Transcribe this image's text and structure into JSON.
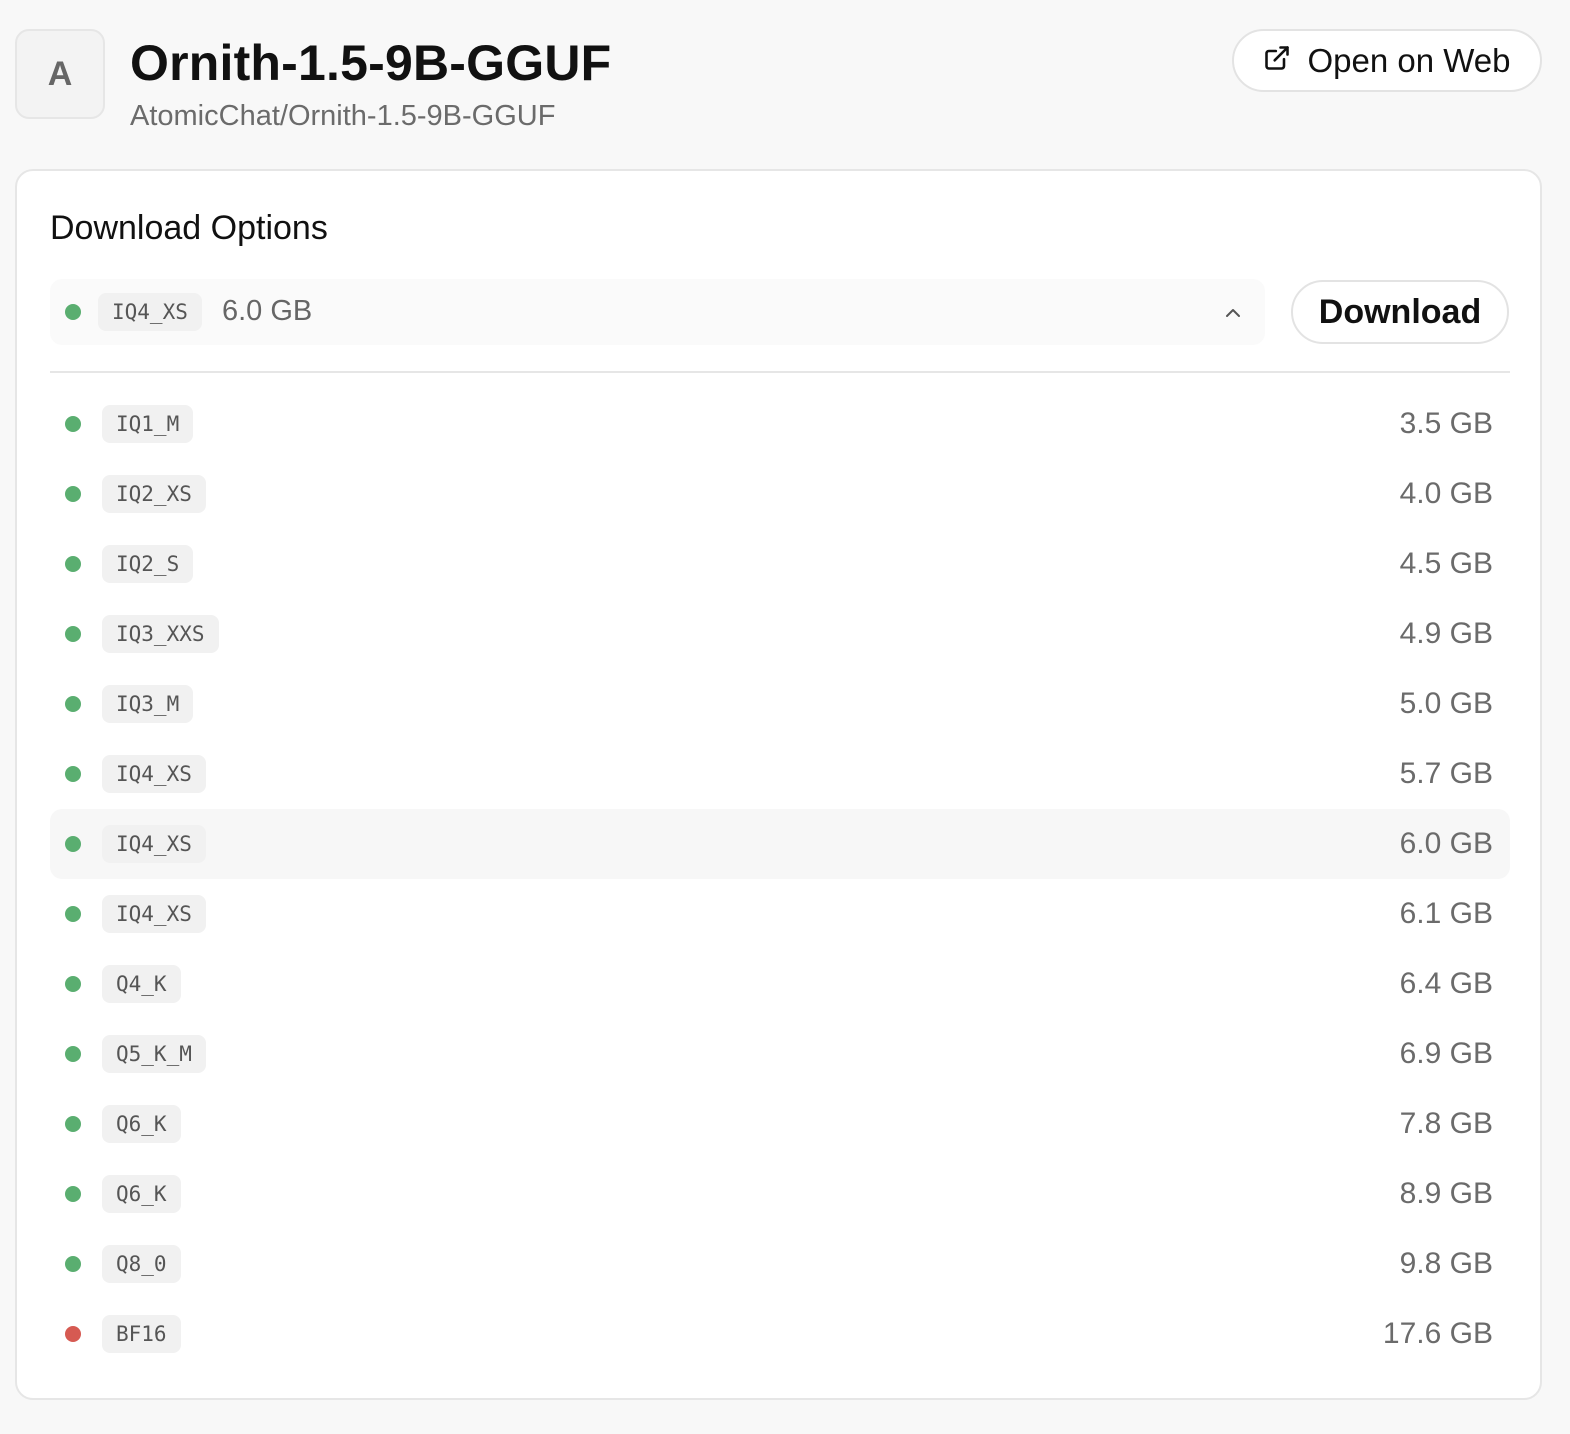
{
  "header": {
    "avatar_letter": "A",
    "title": "Ornith-1.5-9B-GGUF",
    "subtitle": "AtomicChat/Ornith-1.5-9B-GGUF",
    "open_web_label": "Open on Web",
    "open_web_icon": "external-link-icon"
  },
  "download": {
    "section_title": "Download Options",
    "selected": {
      "quant": "IQ4_XS",
      "size": "6.0 GB",
      "status_color": "#5aae70"
    },
    "download_label": "Download",
    "options": [
      {
        "quant": "IQ1_M",
        "size": "3.5 GB",
        "status": "green"
      },
      {
        "quant": "IQ2_XS",
        "size": "4.0 GB",
        "status": "green"
      },
      {
        "quant": "IQ2_S",
        "size": "4.5 GB",
        "status": "green"
      },
      {
        "quant": "IQ3_XXS",
        "size": "4.9 GB",
        "status": "green"
      },
      {
        "quant": "IQ3_M",
        "size": "5.0 GB",
        "status": "green"
      },
      {
        "quant": "IQ4_XS",
        "size": "5.7 GB",
        "status": "green"
      },
      {
        "quant": "IQ4_XS",
        "size": "6.0 GB",
        "status": "green"
      },
      {
        "quant": "IQ4_XS",
        "size": "6.1 GB",
        "status": "green"
      },
      {
        "quant": "Q4_K",
        "size": "6.4 GB",
        "status": "green"
      },
      {
        "quant": "Q5_K_M",
        "size": "6.9 GB",
        "status": "green"
      },
      {
        "quant": "Q6_K",
        "size": "7.8 GB",
        "status": "green"
      },
      {
        "quant": "Q6_K",
        "size": "8.9 GB",
        "status": "green"
      },
      {
        "quant": "Q8_0",
        "size": "9.8 GB",
        "status": "green"
      },
      {
        "quant": "BF16",
        "size": "17.6 GB",
        "status": "red"
      }
    ],
    "selected_index": 6
  },
  "colors": {
    "green": "#5aae70",
    "red": "#d65a52"
  }
}
